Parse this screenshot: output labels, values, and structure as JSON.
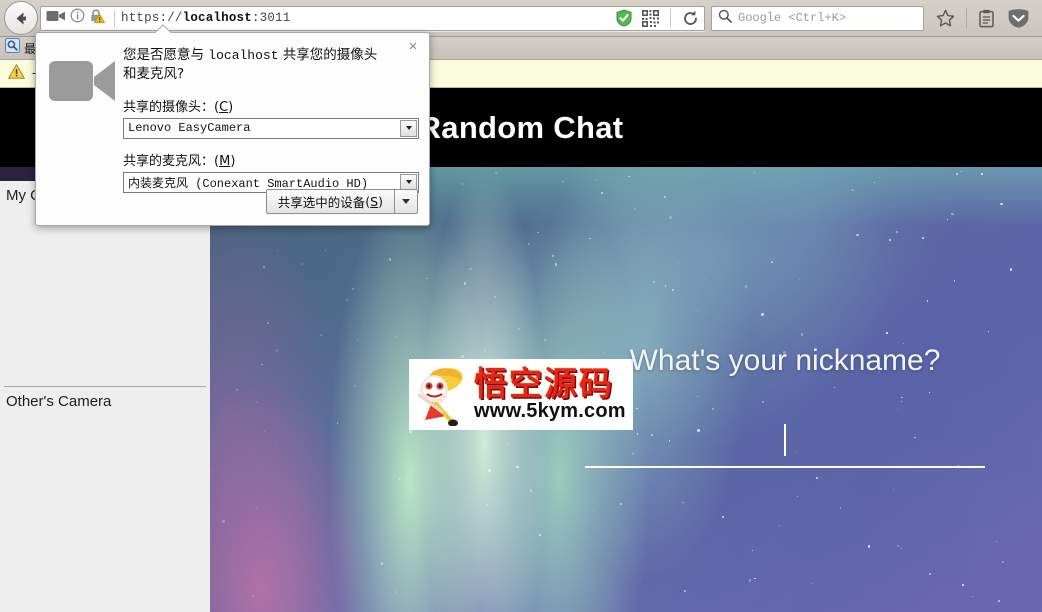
{
  "browser": {
    "back_tooltip": "Back",
    "url": "https://localhost:3011",
    "url_scheme": "https://",
    "url_host": "localhost",
    "url_port": ":3011",
    "search_placeholder": "Google <Ctrl+K>",
    "icons": {
      "back": "back-arrow-icon",
      "camera_sharing": "camera-icon",
      "identity_info": "info-icon",
      "security_lock_warning": "lock-warning-icon",
      "tracking_shield": "green-shield-check-icon",
      "qr_code": "qr-code-icon",
      "reload": "reload-icon",
      "search": "search-icon",
      "bookmark_star": "star-icon",
      "reader_list": "clipboard-icon",
      "downloads_shield": "shield-chevron-icon"
    }
  },
  "bookmarks_bar": {
    "items": [
      {
        "icon": "magnifier-bookmark-icon",
        "label": "最"
      }
    ]
  },
  "notification_bar": {
    "icon": "warning-triangle-icon",
    "text": "一"
  },
  "dialog": {
    "icon": "camera-icon",
    "close_label": "×",
    "question_prefix": "您是否愿意与 ",
    "question_host": "localhost",
    "question_suffix": " 共享您的摄像头和麦克风?",
    "camera_label": "共享的摄像头：",
    "camera_accesskey": "C",
    "camera_value": "Lenovo EasyCamera",
    "mic_label": "共享的麦克风：",
    "mic_accesskey": "M",
    "mic_value": "内装麦克风 (Conexant SmartAudio HD)",
    "share_button_label": "共享选中的设备",
    "share_button_accesskey": "S",
    "share_dropdown_icon": "chevron-down-icon"
  },
  "page": {
    "title": "Random Chat",
    "sidebar": {
      "my_camera_label": "My Camera",
      "others_camera_label": "Other's Camera"
    },
    "nickname": {
      "question": "What's your nickname?",
      "value": "",
      "caret_visible": true
    },
    "watermark": {
      "brand_cn": "悟空源码",
      "url": "www.5kym.com",
      "mascot": "monkey-mascot-icon"
    },
    "colors": {
      "header_bg": "#000000",
      "sidebar_bg": "#eeeeee",
      "accent_band": "#2b2140",
      "title_text": "#ffffff",
      "watermark_red": "#e8241d",
      "notification_bg": "#fbfbdd"
    }
  }
}
